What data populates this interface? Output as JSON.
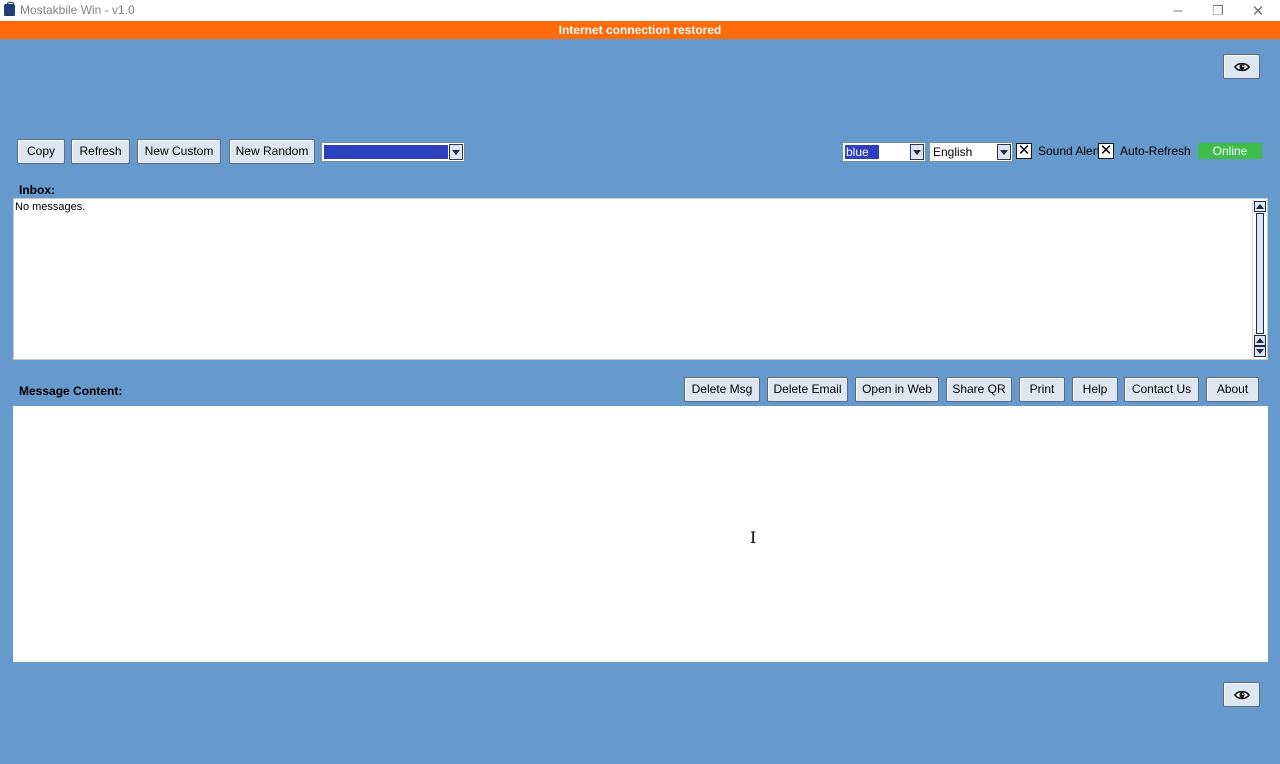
{
  "window": {
    "title": "Mostakbile Win - v1.0",
    "minimize": "─",
    "maximize": "❐",
    "close": "✕"
  },
  "banner": {
    "text": "Internet connection restored"
  },
  "toolbar": {
    "copy": "Copy",
    "refresh": "Refresh",
    "new_custom": "New Custom",
    "new_random": "New Random",
    "email_select_value": ""
  },
  "settings": {
    "theme_value": "blue",
    "language_value": "English",
    "sound_alert_label": "Sound Alert",
    "sound_alert_checked": true,
    "auto_refresh_label": "Auto-Refresh",
    "auto_refresh_checked": true,
    "check_glyph": "✕",
    "status": "Online",
    "status_color": "#3ebd4a"
  },
  "inbox": {
    "label": "Inbox:",
    "empty_text": "No messages."
  },
  "message": {
    "label": "Message Content:",
    "buttons": {
      "delete_msg": "Delete Msg",
      "delete_email": "Delete Email",
      "open_in_web": "Open in Web",
      "share_qr": "Share QR",
      "print": "Print",
      "help": "Help",
      "contact_us": "Contact Us",
      "about": "About"
    }
  },
  "colors": {
    "background": "#6699cc",
    "banner": "#ff6a0a",
    "selection": "#2b3fbf"
  },
  "icons": {
    "visibility": "eye-icon",
    "cursor": "text-cursor-icon"
  }
}
